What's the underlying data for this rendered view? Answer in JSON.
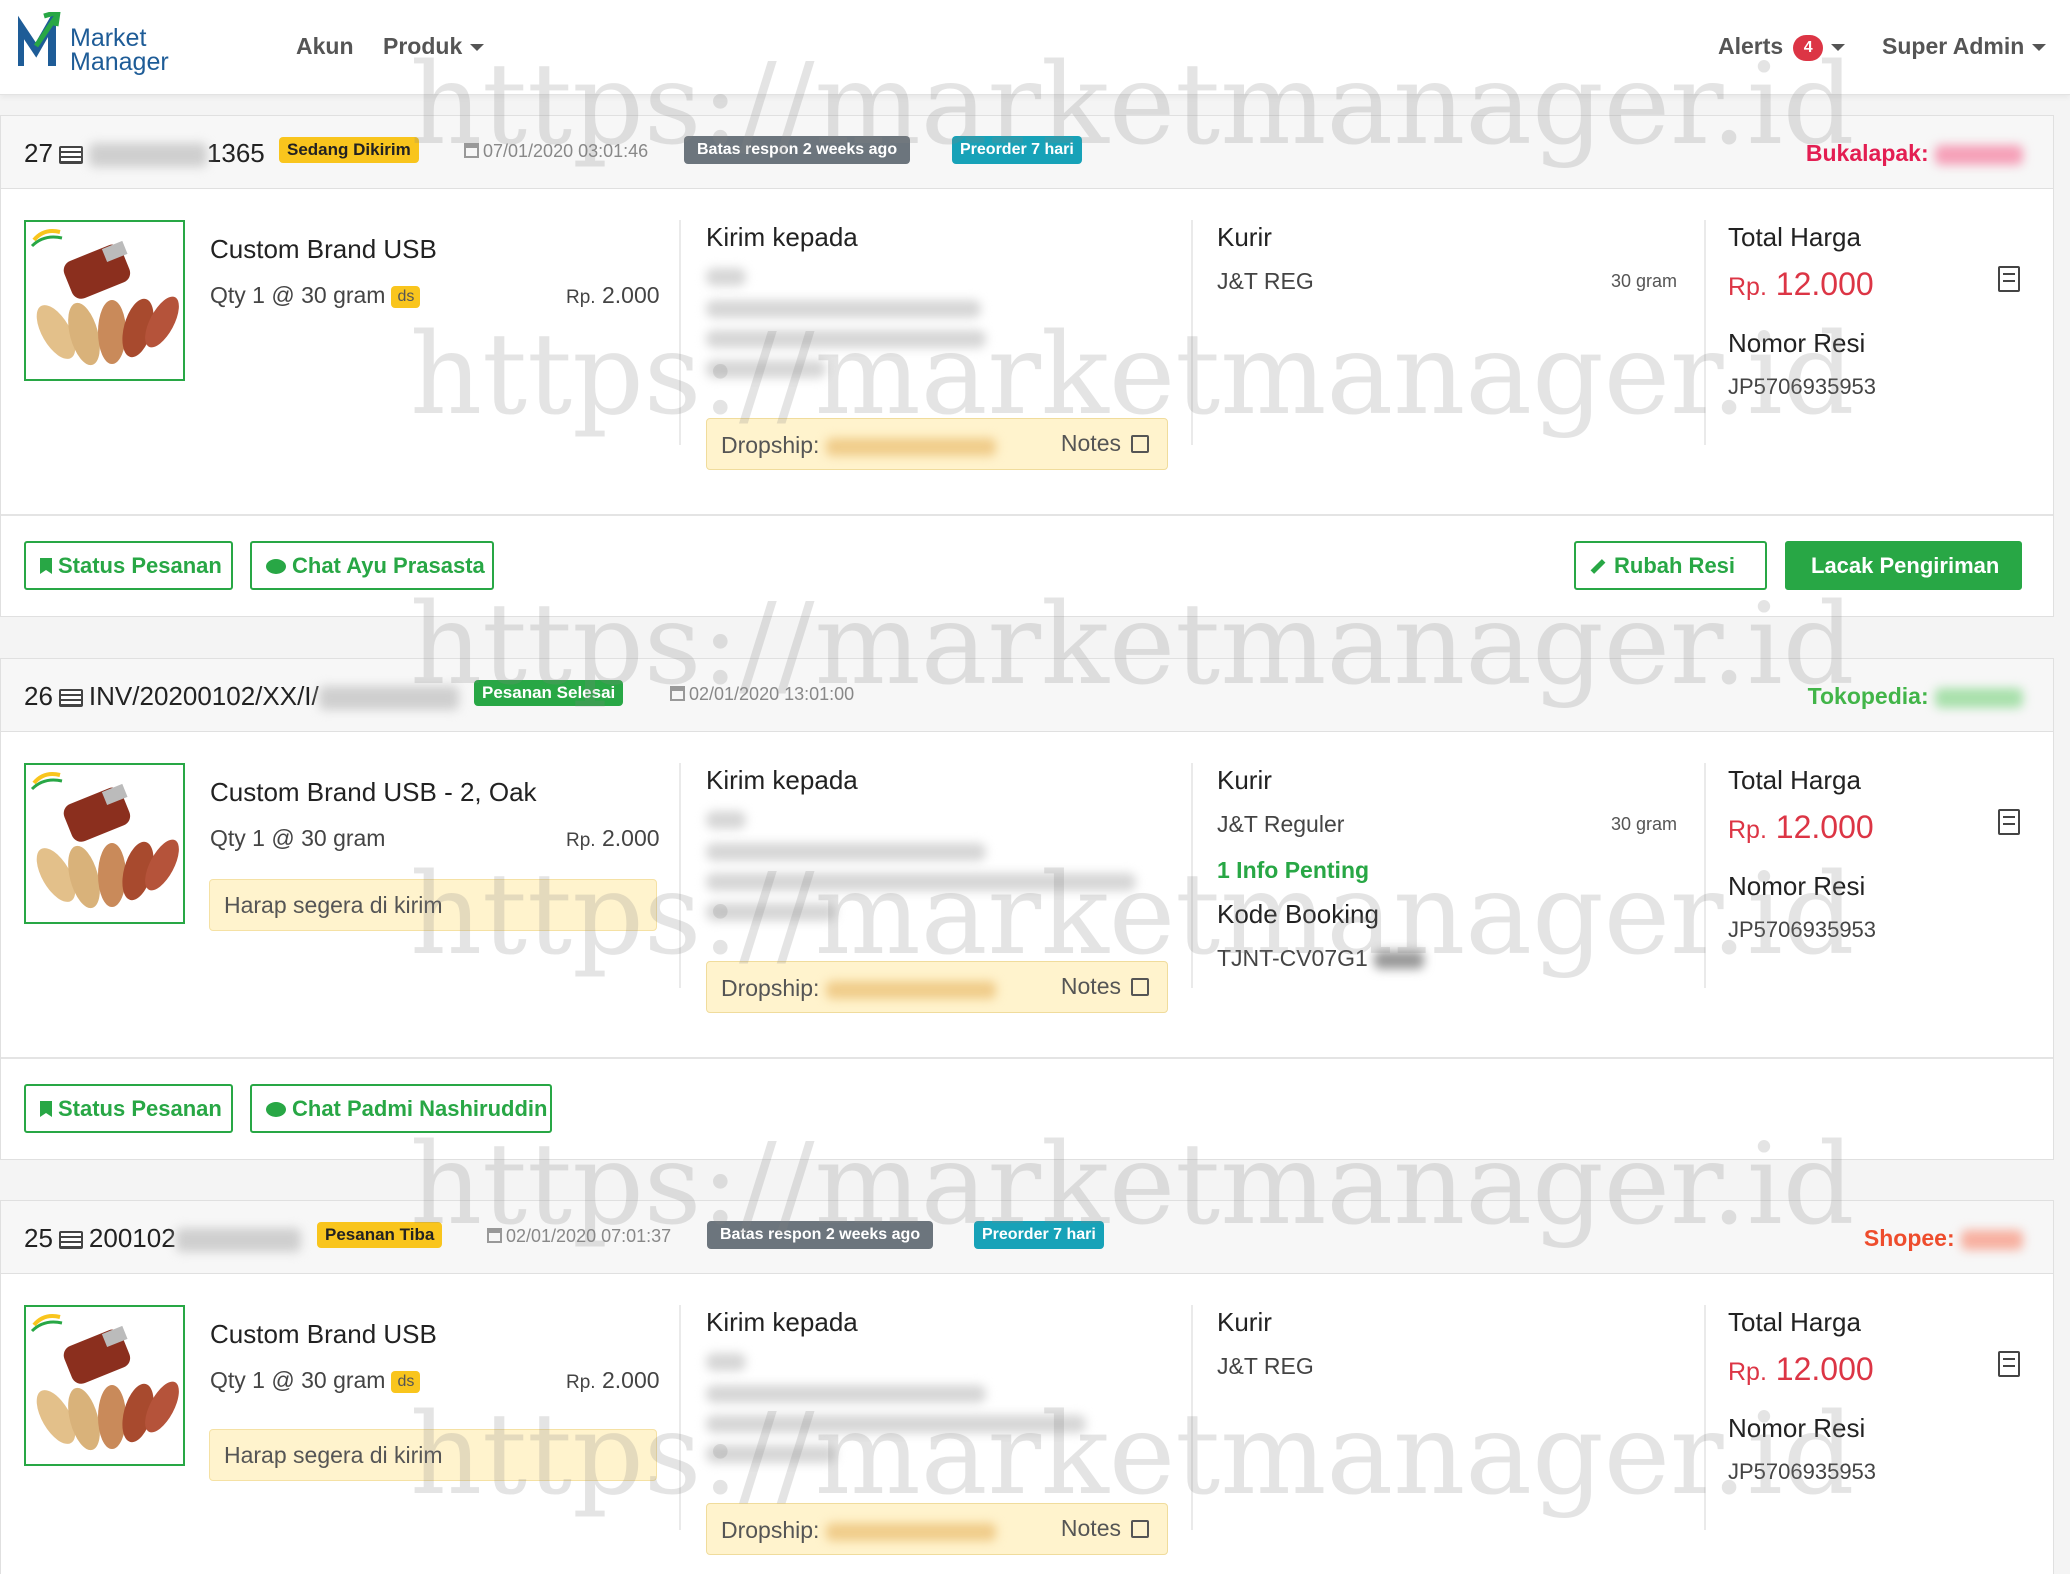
{
  "nav": {
    "brand_line1": "Market",
    "brand_line2": "Manager",
    "akun": "Akun",
    "produk": "Produk",
    "alerts": "Alerts",
    "alerts_count": "4",
    "user": "Super Admin"
  },
  "watermark": "https://marketmanager.id",
  "orders": [
    {
      "number": "27",
      "id_prefix": "",
      "id_suffix": "1365",
      "status": "Sedang Dikirim",
      "datetime": "07/01/2020 03:01:46",
      "response_badge": "Batas respon 2 weeks ago",
      "preorder_badge": "Preorder 7 hari",
      "marketplace": "Bukalapak:",
      "product_name": "Custom Brand USB",
      "qty": "Qty 1 @ 30 gram",
      "ds": "ds",
      "price_prefix": "Rp.",
      "price": "2.000",
      "note": "",
      "ship_title": "Kirim kepada",
      "dropship_label": "Dropship:",
      "notes_label": "Notes",
      "kurir_title": "Kurir",
      "kurir": "J&T REG",
      "weight": "30 gram",
      "total_title": "Total Harga",
      "total_prefix": "Rp.",
      "total": "12.000",
      "resi_title": "Nomor Resi",
      "resi": "JP5706935953",
      "btn_status": "Status Pesanan",
      "btn_chat": "Chat Ayu Prasasta",
      "btn_rubah": "Rubah Resi",
      "btn_lacak": "Lacak Pengiriman"
    },
    {
      "number": "26",
      "id_prefix": "INV/20200102/XX/I/",
      "status": "Pesanan Selesai",
      "datetime": "02/01/2020 13:01:00",
      "marketplace": "Tokopedia:",
      "product_name": "Custom Brand USB - 2, Oak",
      "qty": "Qty 1 @ 30 gram",
      "price_prefix": "Rp.",
      "price": "2.000",
      "note": "Harap segera di kirim",
      "ship_title": "Kirim kepada",
      "dropship_label": "Dropship:",
      "notes_label": "Notes",
      "kurir_title": "Kurir",
      "kurir": "J&T Reguler",
      "weight": "30 gram",
      "info_penting": "1 Info Penting",
      "kode_booking_title": "Kode Booking",
      "kode_booking": "TJNT-CV07G1",
      "total_title": "Total Harga",
      "total_prefix": "Rp.",
      "total": "12.000",
      "resi_title": "Nomor Resi",
      "resi": "JP5706935953",
      "btn_status": "Status Pesanan",
      "btn_chat": "Chat Padmi Nashiruddin"
    },
    {
      "number": "25",
      "id_prefix": "200102",
      "status": "Pesanan Tiba",
      "datetime": "02/01/2020 07:01:37",
      "response_badge": "Batas respon 2 weeks ago",
      "preorder_badge": "Preorder 7 hari",
      "marketplace": "Shopee:",
      "product_name": "Custom Brand USB",
      "qty": "Qty 1 @ 30 gram",
      "ds": "ds",
      "price_prefix": "Rp.",
      "price": "2.000",
      "note": "Harap segera di kirim",
      "ship_title": "Kirim kepada",
      "dropship_label": "Dropship:",
      "notes_label": "Notes",
      "kurir_title": "Kurir",
      "kurir": "J&T REG",
      "total_title": "Total Harga",
      "total_prefix": "Rp.",
      "total": "12.000",
      "resi_title": "Nomor Resi",
      "resi": "JP5706935953"
    }
  ],
  "colors": {
    "green": "#28a745",
    "red": "#dc3545",
    "yellow": "#f9c51d",
    "teal": "#17a2b8",
    "brand": "#1e5c97",
    "bukalapak": "#e31e52",
    "tokopedia": "#42b549",
    "shopee": "#ee4d2d"
  }
}
